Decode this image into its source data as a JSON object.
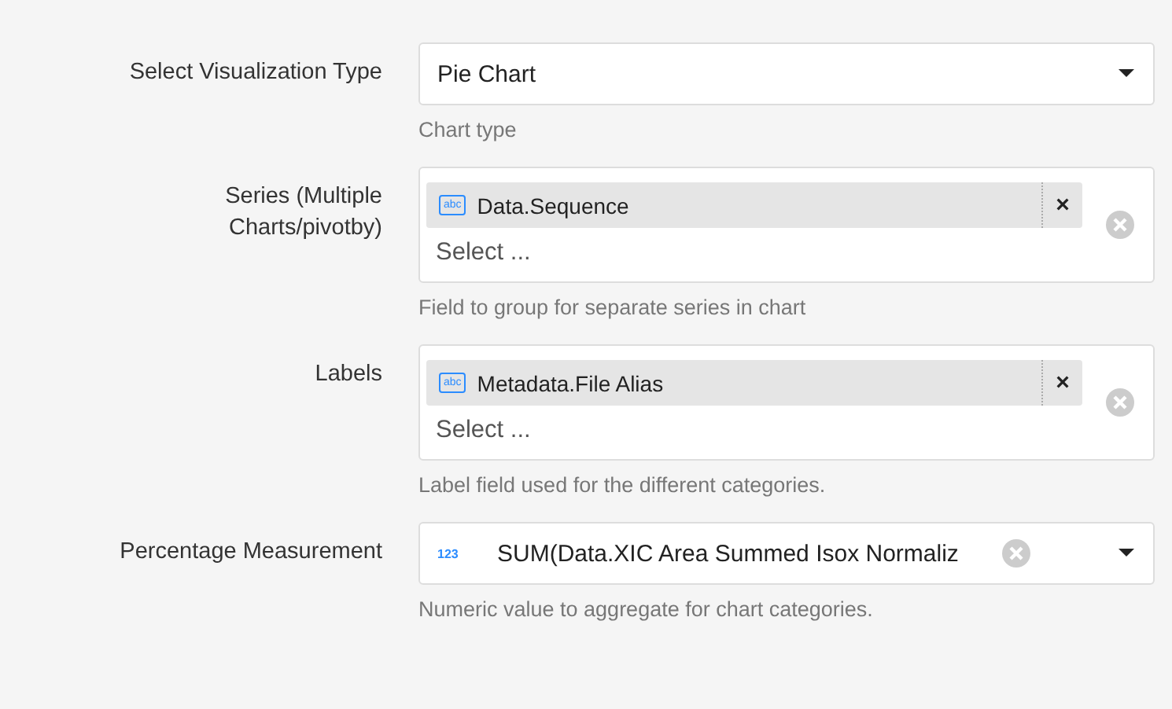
{
  "fields": [
    {
      "kind": "select",
      "label": "Select Visualization Type",
      "value": "Pie Chart",
      "help": "Chart type"
    },
    {
      "kind": "multi",
      "label": "Series (Multiple Charts/pivotby)",
      "tags": [
        {
          "type_icon": "abc",
          "text": "Data.Sequence",
          "remove": "×"
        }
      ],
      "placeholder": "Select ...",
      "help": "Field to group for separate series in chart"
    },
    {
      "kind": "multi",
      "label": "Labels",
      "tags": [
        {
          "type_icon": "abc",
          "text": "Metadata.File Alias",
          "remove": "×"
        }
      ],
      "placeholder": "Select ...",
      "help": "Label field used for the different categories."
    },
    {
      "kind": "typed-select",
      "label": "Percentage Measurement",
      "type_icon": "123",
      "value": "SUM(Data.XIC Area Summed Isox Normaliz",
      "help": "Numeric value to aggregate for chart categories."
    }
  ]
}
